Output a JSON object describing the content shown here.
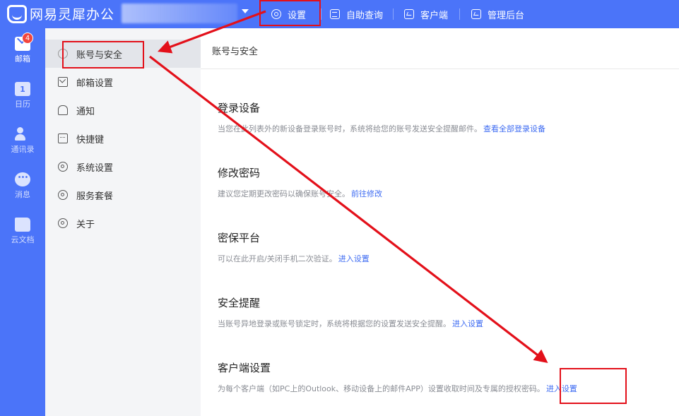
{
  "app": {
    "logo_text": "网易灵犀办公"
  },
  "topbar": {
    "nav": [
      {
        "label": "设置",
        "icon": "settings-hex-icon"
      },
      {
        "label": "自助查询",
        "icon": "query-icon"
      },
      {
        "label": "客户端",
        "icon": "monitor-icon"
      },
      {
        "label": "管理后台",
        "icon": "admin-monitor-icon"
      }
    ]
  },
  "rail": {
    "items": [
      {
        "label": "邮箱",
        "icon": "mail-icon",
        "badge": "4"
      },
      {
        "label": "日历",
        "icon": "calendar-icon",
        "calendar_day": "1"
      },
      {
        "label": "通讯录",
        "icon": "contacts-icon"
      },
      {
        "label": "消息",
        "icon": "message-icon"
      },
      {
        "label": "云文档",
        "icon": "cloud-doc-icon"
      }
    ]
  },
  "sidemenu": {
    "items": [
      {
        "label": "账号与安全",
        "icon": "account-security-icon"
      },
      {
        "label": "邮箱设置",
        "icon": "mail-settings-icon"
      },
      {
        "label": "通知",
        "icon": "bell-icon"
      },
      {
        "label": "快捷键",
        "icon": "keyboard-icon"
      },
      {
        "label": "系统设置",
        "icon": "system-gear-icon"
      },
      {
        "label": "服务套餐",
        "icon": "package-gear-icon"
      },
      {
        "label": "关于",
        "icon": "about-gear-icon"
      }
    ]
  },
  "content": {
    "title": "账号与安全",
    "sections": [
      {
        "title": "登录设备",
        "desc": "当您在此列表外的新设备登录账号时，系统将给您的账号发送安全提醒邮件。",
        "link": "查看全部登录设备"
      },
      {
        "title": "修改密码",
        "desc": "建议您定期更改密码以确保账号安全。",
        "link": "前往修改"
      },
      {
        "title": "密保平台",
        "desc": "可以在此开启/关闭手机二次验证。",
        "link": "进入设置"
      },
      {
        "title": "安全提醒",
        "desc": "当账号异地登录或账号锁定时，系统将根据您的设置发送安全提醒。",
        "link": "进入设置"
      },
      {
        "title": "客户端设置",
        "desc": "为每个客户端（如PC上的Outlook、移动设备上的邮件APP）设置收取时间及专属的授权密码。",
        "link": "进入设置"
      }
    ]
  },
  "annotation_color": "#e3101a",
  "accent_color": "#4b74f9",
  "link_color": "#3d6bf2"
}
